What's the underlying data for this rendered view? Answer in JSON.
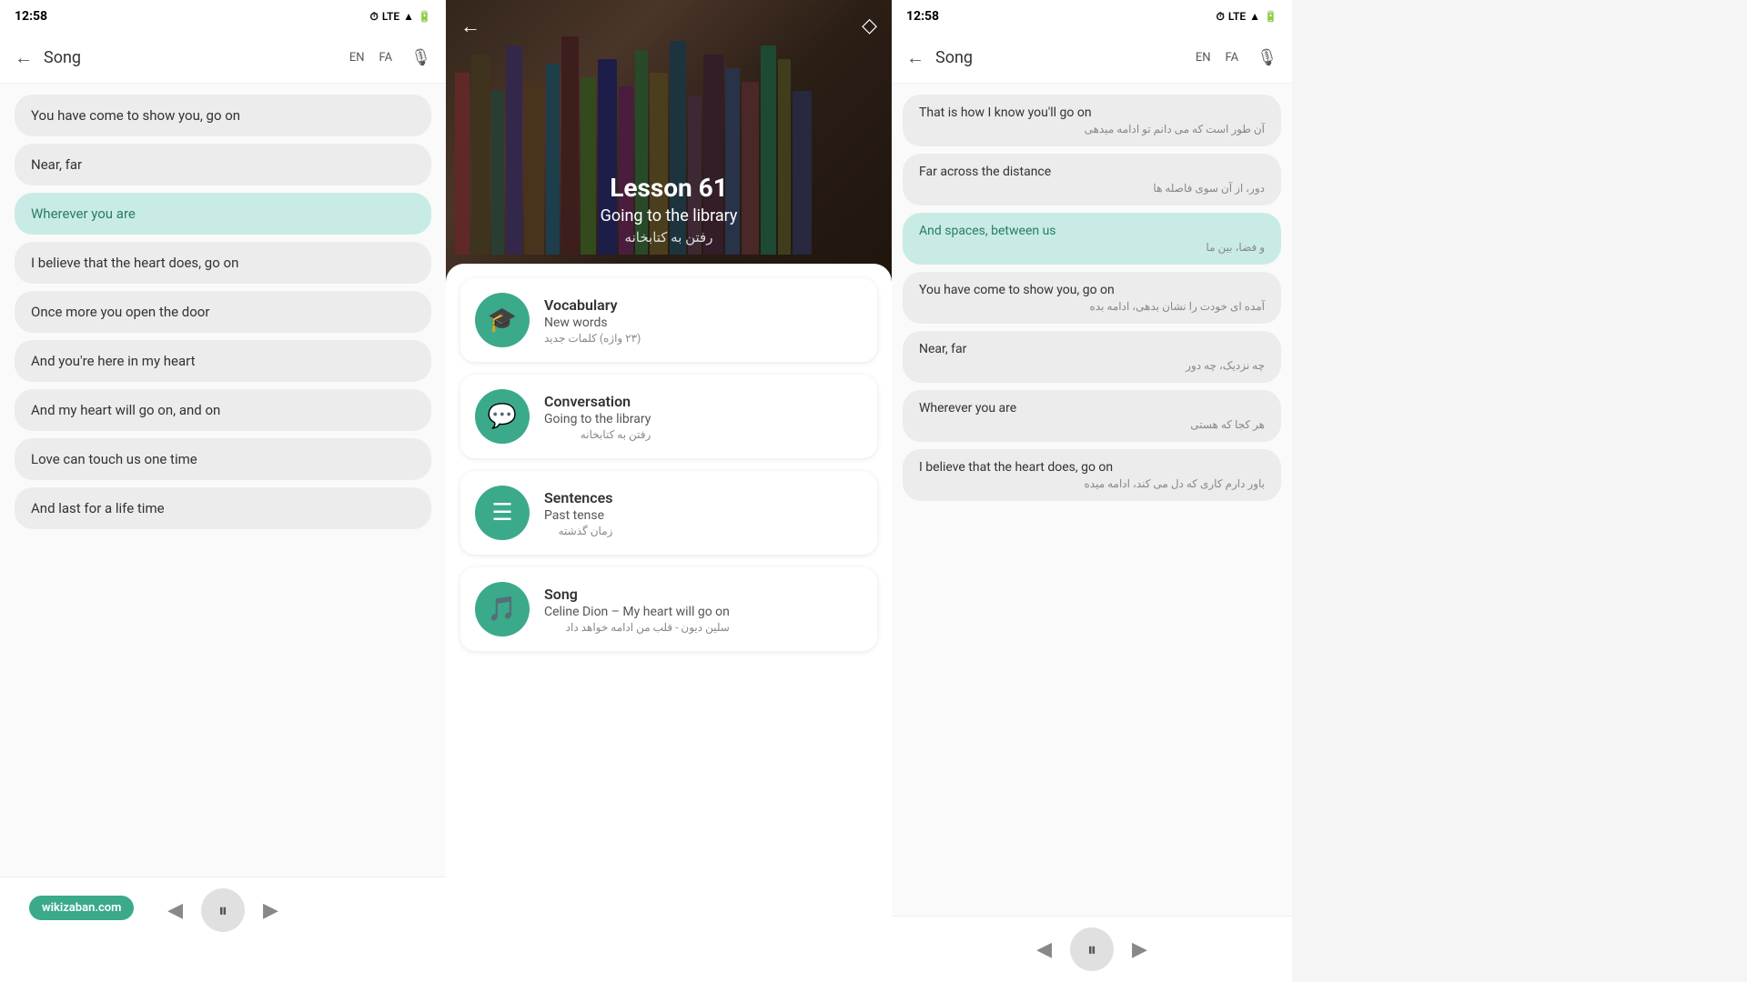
{
  "left_panel": {
    "status": {
      "time": "12:58",
      "icons": "⏱ LTE ▲ 🔋"
    },
    "app_bar": {
      "back": "←",
      "title": "Song",
      "lang1": "EN",
      "lang2": "FA",
      "mic": "🎙"
    },
    "song_items": [
      {
        "text": "You have come to show you, go on",
        "active": false
      },
      {
        "text": "Near, far",
        "active": false
      },
      {
        "text": "Wherever you are",
        "active": true
      },
      {
        "text": "I believe that the heart does, go on",
        "active": false
      },
      {
        "text": "Once more you open the door",
        "active": false
      },
      {
        "text": "And you're here in my heart",
        "active": false
      },
      {
        "text": "And my heart will go on, and on",
        "active": false
      },
      {
        "text": "Love can touch us one time",
        "active": false
      },
      {
        "text": "And last for a life time",
        "active": false
      }
    ],
    "playback": {
      "prev": "◀",
      "pause": "⏸",
      "next": "▶"
    },
    "badge": "wikizaban.com"
  },
  "center_panel": {
    "lesson_num": "Lesson 61",
    "lesson_title": "Going to the library",
    "lesson_fa": "رفتن به کتابخانه",
    "back": "←",
    "bookmark": "◇",
    "cards": [
      {
        "icon": "🎓",
        "title": "Vocabulary",
        "subtitle": "New words",
        "fa": "(۲۳ واژه) کلمات جدید"
      },
      {
        "icon": "💬",
        "title": "Conversation",
        "subtitle": "Going to the library",
        "fa": "رفتن به کتابخانه"
      },
      {
        "icon": "☰",
        "title": "Sentences",
        "subtitle": "Past tense",
        "fa": "زمان گذشته"
      },
      {
        "icon": "🎵",
        "title": "Song",
        "subtitle": "Celine Dion – My heart will go on",
        "fa": "سلین دیون - قلب من ادامه خواهد داد"
      }
    ]
  },
  "right_panel": {
    "status": {
      "time": "12:58",
      "icons": "⏱ LTE ▲ 🔋"
    },
    "app_bar": {
      "back": "←",
      "title": "Song",
      "lang1": "EN",
      "lang2": "FA",
      "mic": "🎙"
    },
    "song_items": [
      {
        "en": "That is how I know you'll go on",
        "fa": "آن طور است که می دانم تو ادامه میدهی",
        "active": false
      },
      {
        "en": "Far across the distance",
        "fa": "دور، از آن سوی فاصله ها",
        "active": false
      },
      {
        "en": "And spaces, between us",
        "fa": "و فضا، بین ما",
        "active": true
      },
      {
        "en": "You have come to show you, go on",
        "fa": "آمده ای خودت را نشان بدهی، ادامه بده",
        "active": false
      },
      {
        "en": "Near, far",
        "fa": "چه نزدیک، چه دور",
        "active": false
      },
      {
        "en": "Wherever you are",
        "fa": "هر کجا که هستی",
        "active": false
      },
      {
        "en": "I believe that the heart does, go on",
        "fa": "باور دارم کاری که دل می کند، ادامه میده",
        "active": false
      }
    ],
    "playback": {
      "prev": "◀",
      "pause": "⏸",
      "next": "▶"
    }
  }
}
